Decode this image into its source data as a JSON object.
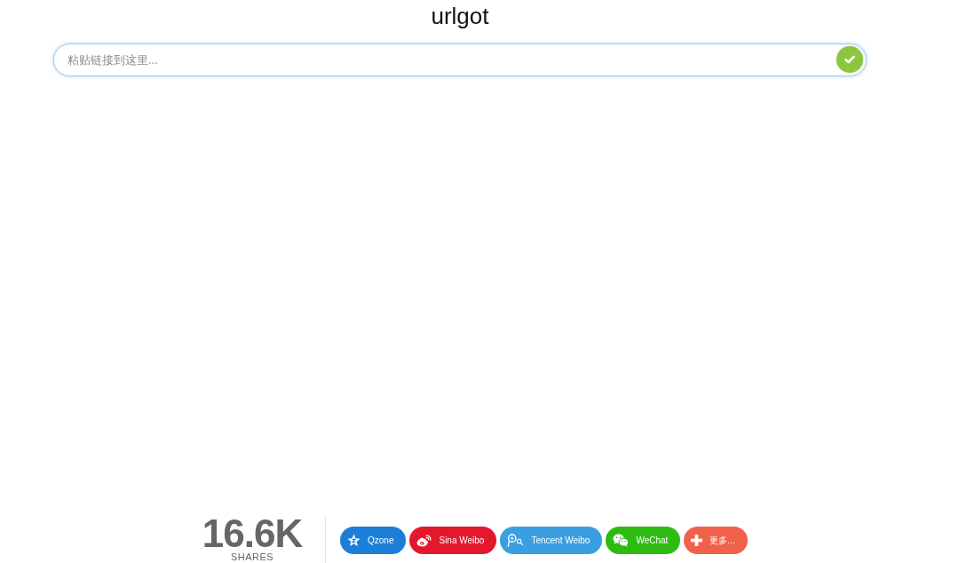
{
  "header": {
    "title": "urlgot"
  },
  "search": {
    "placeholder": "粘贴链接到这里..."
  },
  "share_bar": {
    "count": "16.6K",
    "count_label": "SHARES",
    "buttons": [
      {
        "kind": "qzone",
        "label": "Qzone",
        "color": "#1b7fd8"
      },
      {
        "kind": "sina_weibo",
        "label": "Sina Weibo",
        "color": "#e3182d"
      },
      {
        "kind": "tencent_weibo",
        "label": "Tencent Weibo",
        "color": "#3a9fe0"
      },
      {
        "kind": "wechat",
        "label": "WeChat",
        "color": "#2dbb12"
      },
      {
        "kind": "more",
        "label": "更多...",
        "color": "#f1604b"
      }
    ]
  }
}
